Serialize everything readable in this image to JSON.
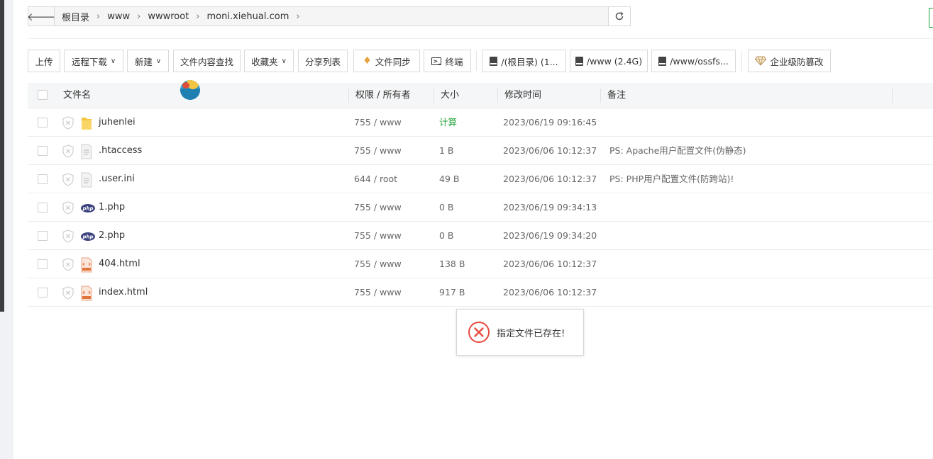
{
  "path": {
    "back_icon": "arrow-left-icon",
    "crumbs": [
      "根目录",
      "www",
      "wwwroot",
      "moni.xiehual.com"
    ],
    "refresh_icon": "refresh-icon"
  },
  "toolbar": {
    "upload": "上传",
    "remote_download": "远程下载",
    "new": "新建",
    "content_search": "文件内容查找",
    "favorites": "收藏夹",
    "share_list": "分享列表",
    "file_sync": "文件同步",
    "terminal": "终端",
    "disk_root": "/(根目录) (1...",
    "disk_www": "/www (2.4G)",
    "disk_ossfs": "/www/ossfs...",
    "tamper_proof": "企业级防篡改"
  },
  "table": {
    "headers": {
      "name": "文件名",
      "perm": "权限 / 所有者",
      "size": "大小",
      "mtime": "修改时间",
      "note": "备注"
    },
    "rows": [
      {
        "name": "juhenlei",
        "type": "folder",
        "perm": "755 / www",
        "size": "计算",
        "mtime": "2023/06/19 09:16:45",
        "note": ""
      },
      {
        "name": ".htaccess",
        "type": "text",
        "perm": "755 / www",
        "size": "1 B",
        "mtime": "2023/06/06 10:12:37",
        "note": "PS: Apache用户配置文件(伪静态)"
      },
      {
        "name": ".user.ini",
        "type": "text",
        "perm": "644 / root",
        "size": "49 B",
        "mtime": "2023/06/06 10:12:37",
        "note": "PS: PHP用户配置文件(防跨站)!"
      },
      {
        "name": "1.php",
        "type": "php",
        "perm": "755 / www",
        "size": "0 B",
        "mtime": "2023/06/19 09:34:13",
        "note": ""
      },
      {
        "name": "2.php",
        "type": "php",
        "perm": "755 / www",
        "size": "0 B",
        "mtime": "2023/06/19 09:34:20",
        "note": ""
      },
      {
        "name": "404.html",
        "type": "html",
        "perm": "755 / www",
        "size": "138 B",
        "mtime": "2023/06/06 10:12:37",
        "note": ""
      },
      {
        "name": "index.html",
        "type": "html",
        "perm": "755 / www",
        "size": "917 B",
        "mtime": "2023/06/06 10:12:37",
        "note": ""
      }
    ]
  },
  "toast": {
    "icon": "error-circle-icon",
    "message": "指定文件已存在!",
    "color": "#e64a3e"
  },
  "colors": {
    "accent_green": "#20a53a",
    "folder_yellow": "#f5c542",
    "php_navy": "#3a4380",
    "html_orange": "#e2743b"
  }
}
